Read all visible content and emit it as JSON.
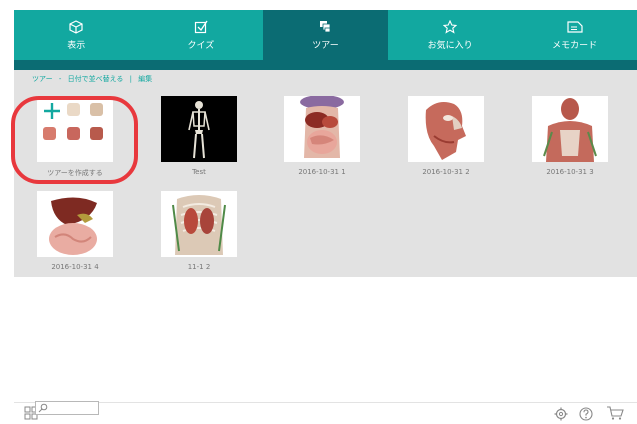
{
  "nav": {
    "tabs": [
      {
        "label": "表示",
        "icon": "cube-icon"
      },
      {
        "label": "クイズ",
        "icon": "checkbox-icon"
      },
      {
        "label": "ツアー",
        "icon": "tour-icon",
        "active": true
      },
      {
        "label": "お気に入り",
        "icon": "star-icon"
      },
      {
        "label": "メモカード",
        "icon": "note-card-icon"
      }
    ]
  },
  "breadcrumb": {
    "items": [
      "ツアー",
      "-",
      "日付で並べ替える",
      "|",
      "編集"
    ]
  },
  "tours": [
    {
      "caption": "ツアーを作成する",
      "kind": "create"
    },
    {
      "caption": "Test",
      "kind": "skeleton"
    },
    {
      "caption": "2016-10-31 1",
      "kind": "torso"
    },
    {
      "caption": "2016-10-31 2",
      "kind": "head"
    },
    {
      "caption": "2016-10-31 3",
      "kind": "upper-body"
    },
    {
      "caption": "2016-10-31 4",
      "kind": "liver"
    },
    {
      "caption": "11-1 2",
      "kind": "ribcage"
    }
  ],
  "colors": {
    "accent": "#12a8a0",
    "active_tab": "#0b6c73",
    "highlight": "#e8383d"
  },
  "footer": {
    "search_placeholder": ""
  }
}
